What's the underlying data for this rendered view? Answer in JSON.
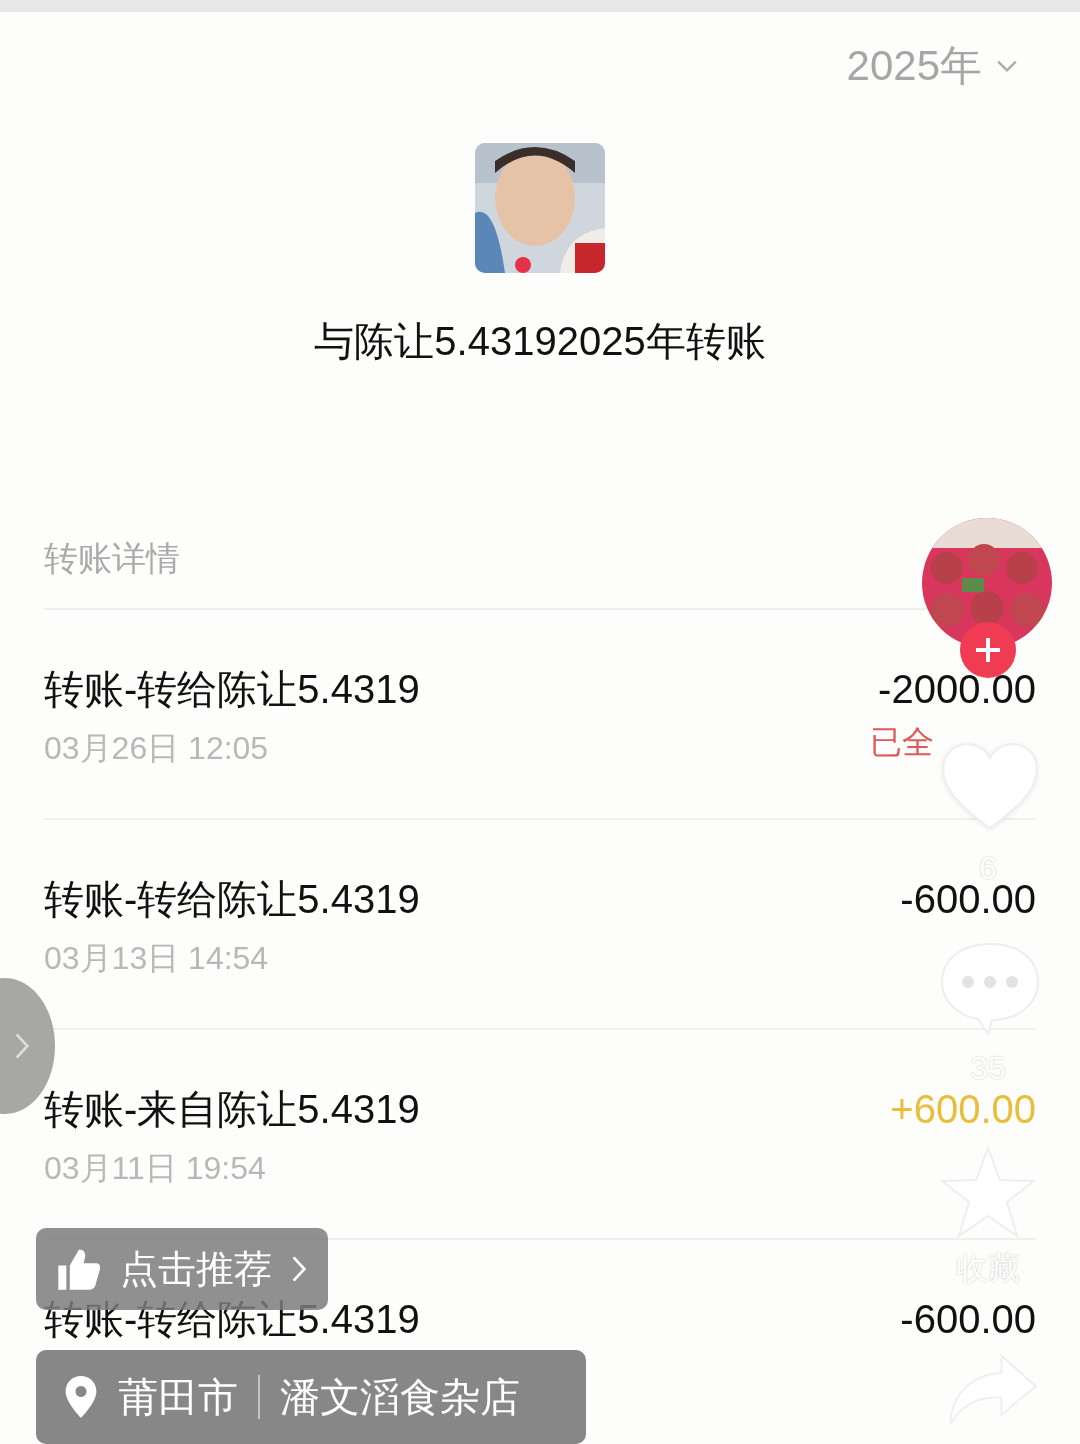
{
  "year_selector": {
    "label": "2025年"
  },
  "header": {
    "title": "与陈让5.43192025年转账"
  },
  "section_title": "转账详情",
  "transactions": [
    {
      "title": "转账-转给陈让5.4319",
      "time": "03月26日 12:05",
      "amount": "-2000.00",
      "kind": "debit",
      "status": "已全"
    },
    {
      "title": "转账-转给陈让5.4319",
      "time": "03月13日 14:54",
      "amount": "-600.00",
      "kind": "debit"
    },
    {
      "title": "转账-来自陈让5.4319",
      "time": "03月11日 19:54",
      "amount": "+600.00",
      "kind": "credit"
    },
    {
      "title": "转账-转给陈让5.4319",
      "amount": "-600.00",
      "kind": "debit"
    }
  ],
  "video_overlay": {
    "likes": "6",
    "comments": "35",
    "favorite_label": "收藏",
    "recommend_button": "点击推荐",
    "location": {
      "city": "莆田市",
      "place": "潘文滔食杂店"
    }
  }
}
